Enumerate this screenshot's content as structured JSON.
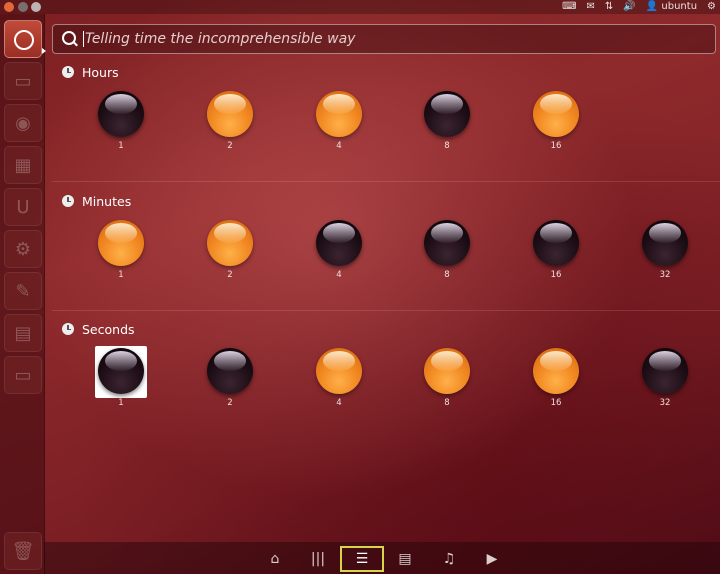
{
  "search": {
    "placeholder": "Telling time the incomprehensible way"
  },
  "tray": {
    "user": "ubuntu"
  },
  "sections": [
    {
      "title": "Hours",
      "bits": [
        {
          "label": "1",
          "on": false
        },
        {
          "label": "2",
          "on": true
        },
        {
          "label": "4",
          "on": true
        },
        {
          "label": "8",
          "on": false
        },
        {
          "label": "16",
          "on": true
        }
      ]
    },
    {
      "title": "Minutes",
      "bits": [
        {
          "label": "1",
          "on": true
        },
        {
          "label": "2",
          "on": true
        },
        {
          "label": "4",
          "on": false
        },
        {
          "label": "8",
          "on": false
        },
        {
          "label": "16",
          "on": false
        },
        {
          "label": "32",
          "on": false
        }
      ]
    },
    {
      "title": "Seconds",
      "bits": [
        {
          "label": "1",
          "on": false,
          "selected": true
        },
        {
          "label": "2",
          "on": false
        },
        {
          "label": "4",
          "on": true
        },
        {
          "label": "8",
          "on": true
        },
        {
          "label": "16",
          "on": true
        },
        {
          "label": "32",
          "on": false
        }
      ]
    }
  ],
  "colors": {
    "accent": "#f28a22",
    "lens_active": "#d9d54a"
  },
  "lenses": [
    {
      "icon": "home-icon",
      "glyph": "⌂"
    },
    {
      "icon": "applications-icon",
      "glyph": "|||"
    },
    {
      "icon": "list-icon",
      "glyph": "☰",
      "active": true
    },
    {
      "icon": "files-icon",
      "glyph": "▤"
    },
    {
      "icon": "music-icon",
      "glyph": "♫"
    },
    {
      "icon": "video-icon",
      "glyph": "▶"
    }
  ]
}
